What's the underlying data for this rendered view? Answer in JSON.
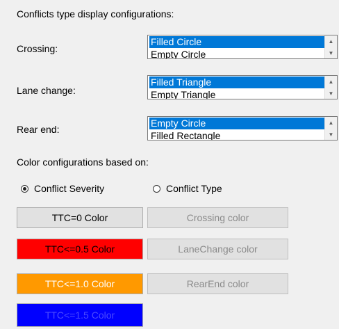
{
  "title": "Conflicts type display configurations:",
  "rows": [
    {
      "label": "Crossing:",
      "selected": "Filled Circle",
      "next": "Empty Circle"
    },
    {
      "label": "Lane change:",
      "selected": "Filled Triangle",
      "next": "Empty Triangle"
    },
    {
      "label": "Rear end:",
      "selected": "Empty Circle",
      "next": "Filled Rectangle"
    }
  ],
  "color_config": {
    "label": "Color configurations based on:",
    "options": [
      {
        "label": "Conflict Severity",
        "checked": true
      },
      {
        "label": "Conflict Type",
        "checked": false
      }
    ]
  },
  "ttc_buttons": [
    {
      "label": "TTC=0 Color",
      "color": "#e1e1e1",
      "text_color": "#000000"
    },
    {
      "label": "TTC<=0.5 Color",
      "color": "#ff0000",
      "text_color": "#000000"
    },
    {
      "label": "TTC<=1.0 Color",
      "color": "#ff9900",
      "text_color": "#ffffff"
    },
    {
      "label": "TTC<=1.5 Color",
      "color": "#0000ff",
      "text_color": "#3333ff"
    }
  ],
  "type_buttons": [
    {
      "label": "Crossing color"
    },
    {
      "label": "LaneChange color"
    },
    {
      "label": "RearEnd color"
    }
  ],
  "icons": {
    "scroll_up": "scroll-up-arrow-icon",
    "scroll_down": "scroll-down-arrow-icon"
  }
}
